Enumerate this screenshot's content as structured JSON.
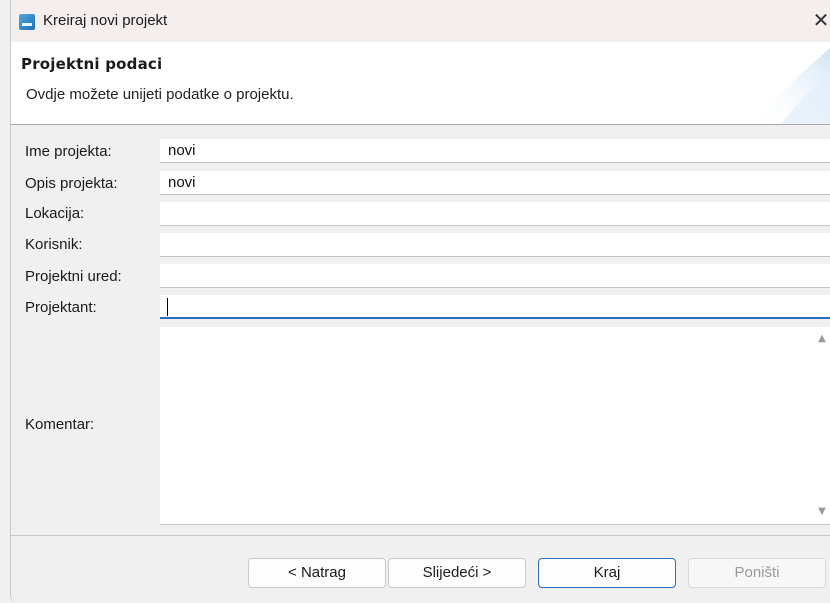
{
  "window": {
    "title": "Kreiraj novi projekt",
    "close_glyph": "✕",
    "icon": "app-icon"
  },
  "header": {
    "title": "Projektni podaci",
    "description": "Ovdje možete unijeti podatke o projektu."
  },
  "form": {
    "fields": [
      {
        "label": "Ime projekta:",
        "value": "novi"
      },
      {
        "label": "Opis projekta:",
        "value": "novi"
      },
      {
        "label": "Lokacija:",
        "value": ""
      },
      {
        "label": "Korisnik:",
        "value": ""
      },
      {
        "label": "Projektni ured:",
        "value": ""
      },
      {
        "label": "Projektant:",
        "value": ""
      }
    ],
    "comment": {
      "label": "Komentar:",
      "value": ""
    }
  },
  "buttons": {
    "back": "< Natrag",
    "next": "Slijedeći >",
    "finish": "Kraj",
    "cancel": "Poništi"
  },
  "colors": {
    "accent": "#2a6ebf",
    "titlebar": "#f4eeee",
    "dialog_bg": "#f0f0f0"
  }
}
